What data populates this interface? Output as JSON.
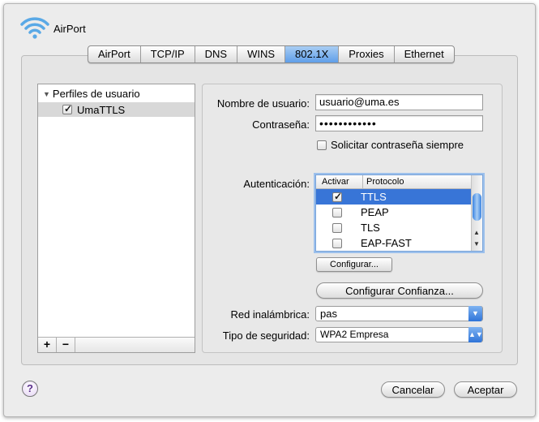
{
  "window": {
    "title": "AirPort"
  },
  "tabs": [
    {
      "label": "AirPort"
    },
    {
      "label": "TCP/IP"
    },
    {
      "label": "DNS"
    },
    {
      "label": "WINS"
    },
    {
      "label": "802.1X",
      "selected": true
    },
    {
      "label": "Proxies"
    },
    {
      "label": "Ethernet"
    }
  ],
  "profiles": {
    "header": "Perfiles de usuario",
    "items": [
      {
        "label": "UmaTTLS",
        "checked": true,
        "selected": true
      }
    ],
    "add_label": "+",
    "remove_label": "−"
  },
  "form": {
    "username_label": "Nombre de usuario:",
    "username_value": "usuario@uma.es",
    "password_label": "Contraseña:",
    "password_value": "••••••••••••",
    "ask_password_label": "Solicitar contraseña siempre",
    "ask_password_checked": false,
    "auth_label": "Autenticación:",
    "auth_table": {
      "col_enable": "Activar",
      "col_protocol": "Protocolo",
      "rows": [
        {
          "protocol": "TTLS",
          "enabled": true,
          "selected": true
        },
        {
          "protocol": "PEAP",
          "enabled": false
        },
        {
          "protocol": "TLS",
          "enabled": false
        },
        {
          "protocol": "EAP-FAST",
          "enabled": false
        }
      ]
    },
    "configure_label": "Configurar...",
    "configure_trust_label": "Configurar Confianza...",
    "wireless_label": "Red inalámbrica:",
    "wireless_value": "pas",
    "security_label": "Tipo de seguridad:",
    "security_value": "WPA2 Empresa"
  },
  "footer": {
    "help_label": "?",
    "cancel_label": "Cancelar",
    "accept_label": "Aceptar"
  },
  "colors": {
    "selection": "#3875d7",
    "accent": "#5f9ee9"
  }
}
